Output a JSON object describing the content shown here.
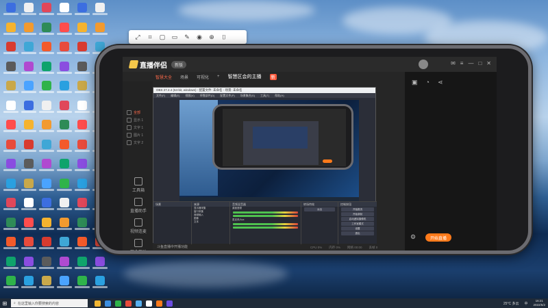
{
  "desktop": {
    "icon_colors": [
      "#3c6ee0",
      "#e84b3c",
      "#2fb34a",
      "#f5b32f",
      "#8a4de0",
      "#f0f0f0",
      "#d83b2f",
      "#2aa0e0",
      "#f29a2f",
      "#5b5b5b",
      "#e0475a",
      "#3fa7d6",
      "#c9a84a",
      "#2e8b57",
      "#b04ad0",
      "#ffffff",
      "#f35a2a",
      "#4aa3ff",
      "#ff4d4d",
      "#0fa36b"
    ]
  },
  "float_toolbar": {
    "icons": [
      "expand-icon",
      "crop-icon",
      "window-icon",
      "screen-icon",
      "brush-icon",
      "record-icon",
      "pin-icon",
      "capture-icon"
    ]
  },
  "app": {
    "name": "直播伴侣",
    "version_badge": "新版",
    "tabs": [
      {
        "label": "智慧大全",
        "active": true
      },
      {
        "label": "场景",
        "active": false
      },
      {
        "label": "可视化",
        "active": false
      },
      {
        "label": "+",
        "active": false
      },
      {
        "label": "智慧区会的主播",
        "active": false
      },
      {
        "label": "新",
        "active": false
      }
    ],
    "scenes": [
      "全部",
      "显示 1",
      "文字 1",
      "图片 1",
      "文字 2"
    ],
    "sidebar": [
      {
        "label": "工具箱",
        "icon": "toolbox-icon"
      },
      {
        "label": "直播助手",
        "icon": "assistant-icon"
      },
      {
        "label": "视频连麦",
        "icon": "video-link-icon"
      },
      {
        "label": "观众互动",
        "icon": "audience-icon"
      },
      {
        "label": "更多",
        "icon": "more-icon"
      }
    ],
    "start_live": "开始直播",
    "bottom_tip": "斗鱼直播中开播功能",
    "status": [
      "CPU 0%",
      "内存 0%",
      "网络 00:00",
      "丢帧 0"
    ]
  },
  "obs": {
    "title": "OBS 27.2.4 (64-bit, windows) - 配置文件: 未命名 - 场景: 未命名",
    "menu": [
      "文件(F)",
      "编辑(E)",
      "视图(V)",
      "停靠部件(D)",
      "配置文件(P)",
      "场景集合(S)",
      "工具(T)",
      "帮助(H)"
    ],
    "docks": {
      "scenes_header": "场景",
      "sources_header": "来源",
      "sources": [
        "显示器采集",
        "窗口采集",
        "音频输入",
        "图像",
        "文本"
      ],
      "mixer_header": "音频混音器",
      "mixer": [
        "桌面音频",
        "麦克风/Aux"
      ],
      "transitions_header": "转场特效",
      "transition_value": "淡出",
      "controls_header": "控制按钮",
      "controls": [
        "开始推流",
        "开始录制",
        "启动虚拟摄像机",
        "工作室模式",
        "设置",
        "退出"
      ]
    },
    "statusbar": "LIVE: 00:00:00  REC: 00:00:00  CPU: 1.3%, 30.00 fps"
  },
  "taskbar": {
    "search_placeholder": "在这里输入你要搜索的内容",
    "weather": "25°C 多云",
    "language": "中",
    "time": "16:21",
    "date": "2022/5/2"
  }
}
